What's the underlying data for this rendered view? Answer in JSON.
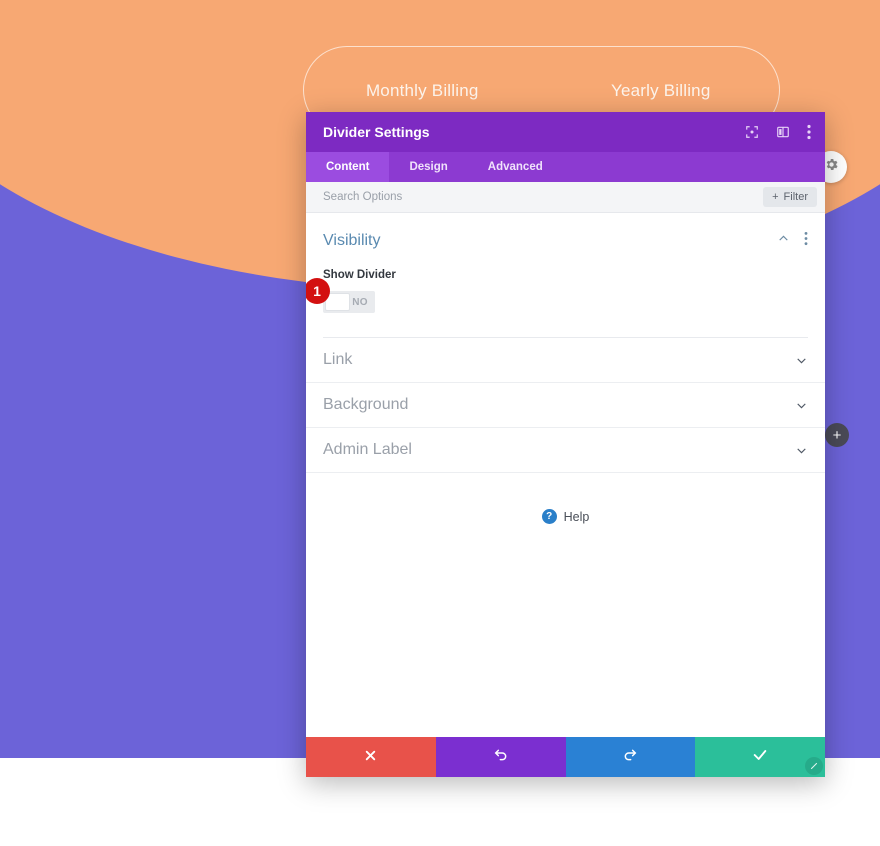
{
  "page_background": {
    "top_color": "#f7a873",
    "bottom_color": "#6c63d8",
    "billing_toggle": {
      "monthly_label": "Monthly Billing",
      "yearly_label": "Yearly Billing"
    },
    "gear_button_icon": "gear-icon",
    "add_button_label": "+"
  },
  "modal": {
    "title": "Divider Settings",
    "header_icons": [
      "focus-target-icon",
      "split-layout-icon",
      "kebab-menu-icon"
    ],
    "tabs": [
      {
        "label": "Content",
        "active": true
      },
      {
        "label": "Design",
        "active": false
      },
      {
        "label": "Advanced",
        "active": false
      }
    ],
    "search": {
      "placeholder": "Search Options",
      "value": ""
    },
    "filter_button": {
      "label": "Filter",
      "icon": "plus-icon"
    },
    "visibility_section": {
      "title": "Visibility",
      "collapse_icon": "chevron-up-icon",
      "menu_icon": "kebab-menu-icon",
      "field": {
        "label": "Show Divider",
        "toggle_value": "NO",
        "badge_number": "1"
      }
    },
    "collapsed_sections": [
      {
        "label": "Link",
        "chevron": "chevron-down-icon"
      },
      {
        "label": "Background",
        "chevron": "chevron-down-icon"
      },
      {
        "label": "Admin Label",
        "chevron": "chevron-down-icon"
      }
    ],
    "help": {
      "icon_glyph": "?",
      "label": "Help"
    },
    "footer_buttons": [
      {
        "name": "cancel",
        "icon": "close-x-icon",
        "color": "#e8524a"
      },
      {
        "name": "undo",
        "icon": "undo-arrow-icon",
        "color": "#7b2fd0"
      },
      {
        "name": "redo",
        "icon": "redo-arrow-icon",
        "color": "#2a81d4"
      },
      {
        "name": "save",
        "icon": "checkmark-icon",
        "color": "#2bbf9a"
      }
    ],
    "resize_handle_icon": "diagonal-resize-icon"
  }
}
